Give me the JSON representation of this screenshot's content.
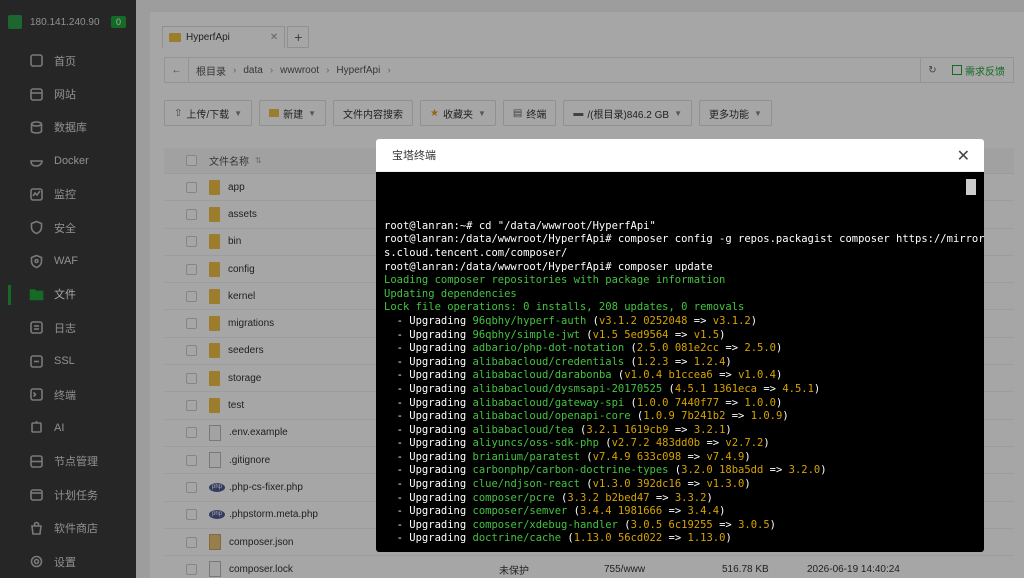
{
  "server": {
    "ip": "180.141.240.90",
    "badge": "0"
  },
  "sidebar": {
    "items": [
      {
        "label": "首页",
        "icon": "home-icon"
      },
      {
        "label": "网站",
        "icon": "globe-icon"
      },
      {
        "label": "数据库",
        "icon": "database-icon"
      },
      {
        "label": "Docker",
        "icon": "docker-icon"
      },
      {
        "label": "监控",
        "icon": "monitor-icon"
      },
      {
        "label": "安全",
        "icon": "shield-icon"
      },
      {
        "label": "WAF",
        "icon": "waf-icon"
      },
      {
        "label": "文件",
        "icon": "folder-icon",
        "active": true
      },
      {
        "label": "日志",
        "icon": "log-icon"
      },
      {
        "label": "SSL",
        "icon": "ssl-icon"
      },
      {
        "label": "终端",
        "icon": "terminal-icon"
      },
      {
        "label": "AI",
        "icon": "ai-icon"
      },
      {
        "label": "节点管理",
        "icon": "node-icon"
      },
      {
        "label": "计划任务",
        "icon": "calendar-icon"
      },
      {
        "label": "软件商店",
        "icon": "store-icon"
      },
      {
        "label": "设置",
        "icon": "gear-icon"
      }
    ]
  },
  "tabs": {
    "active": "HyperfApi",
    "close": "✕",
    "add": "+"
  },
  "breadcrumb": {
    "back": "←",
    "items": [
      "根目录",
      "data",
      "wwwroot",
      "HyperfApi"
    ],
    "refresh": "↻",
    "feedback": "需求反馈"
  },
  "toolbar": {
    "upload": "上传/下载",
    "new": "新建",
    "search": "文件内容搜索",
    "favorites": "收藏夹",
    "terminal": "终端",
    "disk": "/(根目录)846.2 GB",
    "more": "更多功能"
  },
  "filelist": {
    "header": "文件名称",
    "rows": [
      {
        "name": "app",
        "type": "folder"
      },
      {
        "name": "assets",
        "type": "folder"
      },
      {
        "name": "bin",
        "type": "folder"
      },
      {
        "name": "config",
        "type": "folder"
      },
      {
        "name": "kernel",
        "type": "folder"
      },
      {
        "name": "migrations",
        "type": "folder"
      },
      {
        "name": "seeders",
        "type": "folder"
      },
      {
        "name": "storage",
        "type": "folder"
      },
      {
        "name": "test",
        "type": "folder"
      },
      {
        "name": ".env.example",
        "type": "file"
      },
      {
        "name": ".gitignore",
        "type": "file"
      },
      {
        "name": ".php-cs-fixer.php",
        "type": "php"
      },
      {
        "name": ".phpstorm.meta.php",
        "type": "php"
      },
      {
        "name": "composer.json",
        "type": "json"
      },
      {
        "name": "composer.lock",
        "type": "file"
      }
    ],
    "last_row_meta": {
      "protect": "未保护",
      "perm": "755/www",
      "size": "516.78 KB",
      "time": "2026-06-19 14:40:24"
    }
  },
  "modal": {
    "title": "宝塔终端",
    "close": "✕"
  },
  "terminal": {
    "lines": [
      {
        "parts": [
          [
            "w",
            "root@lanran:~# cd \"/data/wwwroot/HyperfApi\""
          ]
        ]
      },
      {
        "parts": [
          [
            "w",
            "root@lanran:/data/wwwroot/HyperfApi# composer config -g repos.packagist composer https://mirror"
          ]
        ]
      },
      {
        "parts": [
          [
            "w",
            "s.cloud.tencent.com/composer/"
          ]
        ]
      },
      {
        "parts": [
          [
            "w",
            "root@lanran:/data/wwwroot/HyperfApi# composer update"
          ]
        ]
      },
      {
        "parts": [
          [
            "g",
            "Loading composer repositories with package information"
          ]
        ]
      },
      {
        "parts": [
          [
            "g",
            "Updating dependencies"
          ]
        ]
      },
      {
        "parts": [
          [
            "g",
            "Lock file operations: 0 installs, 208 updates, 0 removals"
          ]
        ]
      },
      {
        "parts": [
          [
            "w",
            "  - Upgrading "
          ],
          [
            "g",
            "96qbhy/hyperf-auth"
          ],
          [
            "w",
            " ("
          ],
          [
            "y",
            "v3.1.2 0252048"
          ],
          [
            "w",
            " => "
          ],
          [
            "y",
            "v3.1.2"
          ],
          [
            "w",
            ")"
          ]
        ]
      },
      {
        "parts": [
          [
            "w",
            "  - Upgrading "
          ],
          [
            "g",
            "96qbhy/simple-jwt"
          ],
          [
            "w",
            " ("
          ],
          [
            "y",
            "v1.5 5ed9564"
          ],
          [
            "w",
            " => "
          ],
          [
            "y",
            "v1.5"
          ],
          [
            "w",
            ")"
          ]
        ]
      },
      {
        "parts": [
          [
            "w",
            "  - Upgrading "
          ],
          [
            "g",
            "adbario/php-dot-notation"
          ],
          [
            "w",
            " ("
          ],
          [
            "y",
            "2.5.0 081e2cc"
          ],
          [
            "w",
            " => "
          ],
          [
            "y",
            "2.5.0"
          ],
          [
            "w",
            ")"
          ]
        ]
      },
      {
        "parts": [
          [
            "w",
            "  - Upgrading "
          ],
          [
            "g",
            "alibabacloud/credentials"
          ],
          [
            "w",
            " ("
          ],
          [
            "y",
            "1.2.3"
          ],
          [
            "w",
            " => "
          ],
          [
            "y",
            "1.2.4"
          ],
          [
            "w",
            ")"
          ]
        ]
      },
      {
        "parts": [
          [
            "w",
            "  - Upgrading "
          ],
          [
            "g",
            "alibabacloud/darabonba"
          ],
          [
            "w",
            " ("
          ],
          [
            "y",
            "v1.0.4 b1ccea6"
          ],
          [
            "w",
            " => "
          ],
          [
            "y",
            "v1.0.4"
          ],
          [
            "w",
            ")"
          ]
        ]
      },
      {
        "parts": [
          [
            "w",
            "  - Upgrading "
          ],
          [
            "g",
            "alibabacloud/dysmsapi-20170525"
          ],
          [
            "w",
            " ("
          ],
          [
            "y",
            "4.5.1 1361eca"
          ],
          [
            "w",
            " => "
          ],
          [
            "y",
            "4.5.1"
          ],
          [
            "w",
            ")"
          ]
        ]
      },
      {
        "parts": [
          [
            "w",
            "  - Upgrading "
          ],
          [
            "g",
            "alibabacloud/gateway-spi"
          ],
          [
            "w",
            " ("
          ],
          [
            "y",
            "1.0.0 7440f77"
          ],
          [
            "w",
            " => "
          ],
          [
            "y",
            "1.0.0"
          ],
          [
            "w",
            ")"
          ]
        ]
      },
      {
        "parts": [
          [
            "w",
            "  - Upgrading "
          ],
          [
            "g",
            "alibabacloud/openapi-core"
          ],
          [
            "w",
            " ("
          ],
          [
            "y",
            "1.0.9 7b241b2"
          ],
          [
            "w",
            " => "
          ],
          [
            "y",
            "1.0.9"
          ],
          [
            "w",
            ")"
          ]
        ]
      },
      {
        "parts": [
          [
            "w",
            "  - Upgrading "
          ],
          [
            "g",
            "alibabacloud/tea"
          ],
          [
            "w",
            " ("
          ],
          [
            "y",
            "3.2.1 1619cb9"
          ],
          [
            "w",
            " => "
          ],
          [
            "y",
            "3.2.1"
          ],
          [
            "w",
            ")"
          ]
        ]
      },
      {
        "parts": [
          [
            "w",
            "  - Upgrading "
          ],
          [
            "g",
            "aliyuncs/oss-sdk-php"
          ],
          [
            "w",
            " ("
          ],
          [
            "y",
            "v2.7.2 483dd0b"
          ],
          [
            "w",
            " => "
          ],
          [
            "y",
            "v2.7.2"
          ],
          [
            "w",
            ")"
          ]
        ]
      },
      {
        "parts": [
          [
            "w",
            "  - Upgrading "
          ],
          [
            "g",
            "brianium/paratest"
          ],
          [
            "w",
            " ("
          ],
          [
            "y",
            "v7.4.9 633c098"
          ],
          [
            "w",
            " => "
          ],
          [
            "y",
            "v7.4.9"
          ],
          [
            "w",
            ")"
          ]
        ]
      },
      {
        "parts": [
          [
            "w",
            "  - Upgrading "
          ],
          [
            "g",
            "carbonphp/carbon-doctrine-types"
          ],
          [
            "w",
            " ("
          ],
          [
            "y",
            "3.2.0 18ba5dd"
          ],
          [
            "w",
            " => "
          ],
          [
            "y",
            "3.2.0"
          ],
          [
            "w",
            ")"
          ]
        ]
      },
      {
        "parts": [
          [
            "w",
            "  - Upgrading "
          ],
          [
            "g",
            "clue/ndjson-react"
          ],
          [
            "w",
            " ("
          ],
          [
            "y",
            "v1.3.0 392dc16"
          ],
          [
            "w",
            " => "
          ],
          [
            "y",
            "v1.3.0"
          ],
          [
            "w",
            ")"
          ]
        ]
      },
      {
        "parts": [
          [
            "w",
            "  - Upgrading "
          ],
          [
            "g",
            "composer/pcre"
          ],
          [
            "w",
            " ("
          ],
          [
            "y",
            "3.3.2 b2bed47"
          ],
          [
            "w",
            " => "
          ],
          [
            "y",
            "3.3.2"
          ],
          [
            "w",
            ")"
          ]
        ]
      },
      {
        "parts": [
          [
            "w",
            "  - Upgrading "
          ],
          [
            "g",
            "composer/semver"
          ],
          [
            "w",
            " ("
          ],
          [
            "y",
            "3.4.4 1981666"
          ],
          [
            "w",
            " => "
          ],
          [
            "y",
            "3.4.4"
          ],
          [
            "w",
            ")"
          ]
        ]
      },
      {
        "parts": [
          [
            "w",
            "  - Upgrading "
          ],
          [
            "g",
            "composer/xdebug-handler"
          ],
          [
            "w",
            " ("
          ],
          [
            "y",
            "3.0.5 6c19255"
          ],
          [
            "w",
            " => "
          ],
          [
            "y",
            "3.0.5"
          ],
          [
            "w",
            ")"
          ]
        ]
      },
      {
        "parts": [
          [
            "w",
            "  - Upgrading "
          ],
          [
            "g",
            "doctrine/cache"
          ],
          [
            "w",
            " ("
          ],
          [
            "y",
            "1.13.0 56cd022"
          ],
          [
            "w",
            " => "
          ],
          [
            "y",
            "1.13.0"
          ],
          [
            "w",
            ")"
          ]
        ]
      }
    ]
  }
}
